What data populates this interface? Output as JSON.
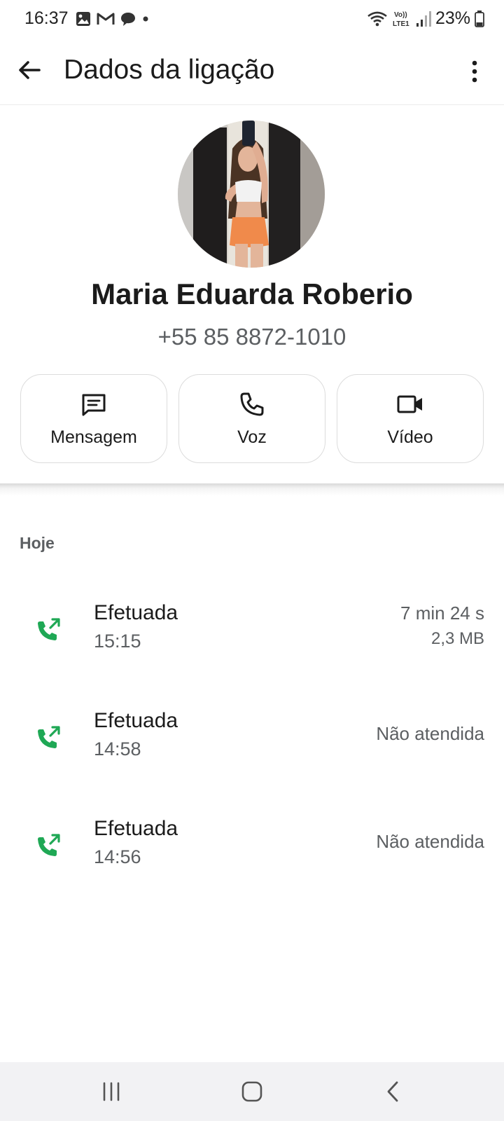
{
  "status_bar": {
    "time": "16:37",
    "left_icons": [
      "image-icon",
      "gmail-icon",
      "chat-bubble-icon",
      "dot-icon"
    ],
    "network_label": "Vo) LTE1",
    "battery": "23%"
  },
  "app_bar": {
    "title": "Dados da ligação",
    "back_icon": "arrow-left-icon",
    "more_icon": "more-vert-icon"
  },
  "contact": {
    "name": "Maria Eduarda Roberio",
    "phone": "+55 85 8872-1010"
  },
  "actions": [
    {
      "label": "Mensagem",
      "icon": "message-icon"
    },
    {
      "label": "Voz",
      "icon": "phone-icon"
    },
    {
      "label": "Vídeo",
      "icon": "video-icon"
    }
  ],
  "calls": {
    "heading": "Hoje",
    "items": [
      {
        "type": "Efetuada",
        "time": "15:15",
        "duration": "7 min 24 s",
        "size": "2,3 MB",
        "status": ""
      },
      {
        "type": "Efetuada",
        "time": "14:58",
        "duration": "",
        "size": "",
        "status": "Não atendida"
      },
      {
        "type": "Efetuada",
        "time": "14:56",
        "duration": "",
        "size": "",
        "status": "Não atendida"
      }
    ]
  },
  "colors": {
    "accent_green": "#1fa855",
    "text_primary": "#1b1b1b",
    "text_secondary": "#5c5f62",
    "nav_bg": "#f2f2f4"
  },
  "nav_bar": {
    "icons": [
      "recent-apps-icon",
      "home-icon",
      "back-nav-icon"
    ]
  }
}
